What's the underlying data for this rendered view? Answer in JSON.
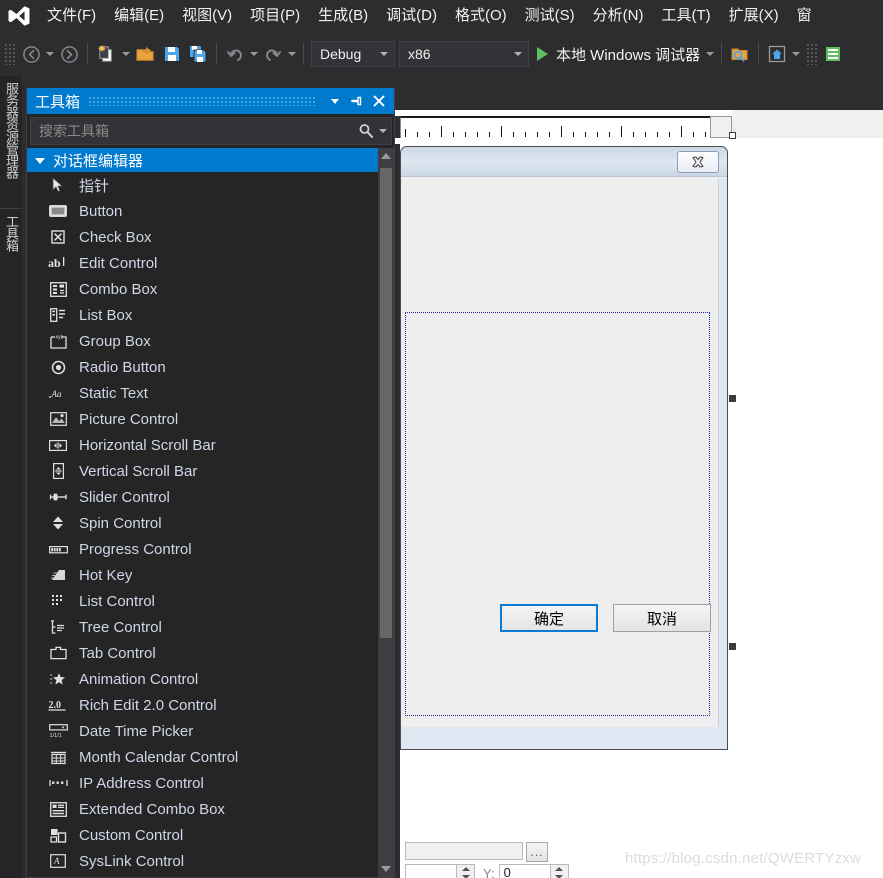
{
  "app": {
    "logo_icon": "visual-studio-logo-icon",
    "accent": "#007acc",
    "chrome_bg": "#2d2d30"
  },
  "menubar": {
    "items": [
      {
        "label": "文件(F)",
        "name": "menu-file"
      },
      {
        "label": "编辑(E)",
        "name": "menu-edit"
      },
      {
        "label": "视图(V)",
        "name": "menu-view"
      },
      {
        "label": "项目(P)",
        "name": "menu-project"
      },
      {
        "label": "生成(B)",
        "name": "menu-build"
      },
      {
        "label": "调试(D)",
        "name": "menu-debug"
      },
      {
        "label": "格式(O)",
        "name": "menu-format"
      },
      {
        "label": "测试(S)",
        "name": "menu-test"
      },
      {
        "label": "分析(N)",
        "name": "menu-analyze"
      },
      {
        "label": "工具(T)",
        "name": "menu-tools"
      },
      {
        "label": "扩展(X)",
        "name": "menu-extensions"
      },
      {
        "label": "窗",
        "name": "menu-window"
      }
    ]
  },
  "toolbar": {
    "back_icon": "navigate-back-icon",
    "forward_icon": "navigate-forward-icon",
    "new_item_icon": "new-item-icon",
    "open_icon": "open-file-icon",
    "save_icon": "save-icon",
    "save_all_icon": "save-all-icon",
    "undo_icon": "undo-icon",
    "redo_icon": "redo-icon",
    "config_value": "Debug",
    "platform_value": "x86",
    "run_label": "本地 Windows 调试器",
    "run_icon": "play-icon",
    "find_icon": "find-in-files-icon",
    "home_icon": "home-window-icon",
    "panel_icon": "panel-icon"
  },
  "vertical_dock": {
    "tabs": [
      {
        "label": "服务器资源管理器",
        "name": "vdock-tab-server-explorer"
      },
      {
        "label": "工具箱",
        "name": "vdock-tab-toolbox"
      }
    ]
  },
  "toolbox": {
    "title": "工具箱",
    "dropdown_icon": "chevron-down-icon",
    "pin_icon": "pin-icon",
    "close_icon": "close-icon",
    "search": {
      "placeholder": "搜索工具箱",
      "value": "",
      "icon": "search-icon",
      "caret_icon": "chevron-down-icon"
    },
    "group": {
      "label": "对话框编辑器",
      "expanded": true,
      "selected": true
    },
    "items": [
      {
        "label": "指针",
        "icon": "pointer-icon"
      },
      {
        "label": "Button",
        "icon": "button-icon"
      },
      {
        "label": "Check Box",
        "icon": "check-box-icon"
      },
      {
        "label": "Edit Control",
        "icon": "edit-control-icon"
      },
      {
        "label": "Combo Box",
        "icon": "combo-box-icon"
      },
      {
        "label": "List Box",
        "icon": "list-box-icon"
      },
      {
        "label": "Group Box",
        "icon": "group-box-icon"
      },
      {
        "label": "Radio Button",
        "icon": "radio-button-icon"
      },
      {
        "label": "Static Text",
        "icon": "static-text-icon"
      },
      {
        "label": "Picture Control",
        "icon": "picture-control-icon"
      },
      {
        "label": "Horizontal Scroll Bar",
        "icon": "horizontal-scroll-bar-icon"
      },
      {
        "label": "Vertical Scroll Bar",
        "icon": "vertical-scroll-bar-icon"
      },
      {
        "label": "Slider Control",
        "icon": "slider-control-icon"
      },
      {
        "label": "Spin Control",
        "icon": "spin-control-icon"
      },
      {
        "label": "Progress Control",
        "icon": "progress-control-icon"
      },
      {
        "label": "Hot Key",
        "icon": "hot-key-icon"
      },
      {
        "label": "List Control",
        "icon": "list-control-icon"
      },
      {
        "label": "Tree Control",
        "icon": "tree-control-icon"
      },
      {
        "label": "Tab Control",
        "icon": "tab-control-icon"
      },
      {
        "label": "Animation Control",
        "icon": "animation-control-icon"
      },
      {
        "label": "Rich Edit 2.0 Control",
        "icon": "rich-edit-2-icon"
      },
      {
        "label": "Date Time Picker",
        "icon": "date-time-picker-icon"
      },
      {
        "label": "Month Calendar Control",
        "icon": "month-calendar-icon"
      },
      {
        "label": "IP Address Control",
        "icon": "ip-address-icon"
      },
      {
        "label": "Extended Combo Box",
        "icon": "extended-combo-box-icon"
      },
      {
        "label": "Custom Control",
        "icon": "custom-control-icon"
      },
      {
        "label": "SysLink Control",
        "icon": "syslink-control-icon"
      }
    ],
    "scrollbar": {
      "up_icon": "scroll-up-icon",
      "down_icon": "scroll-down-icon"
    }
  },
  "editor": {
    "ruler_icon": "ruler-corner-icon",
    "dialog": {
      "close_icon": "dialog-close-icon",
      "ok_label": "确定",
      "cancel_label": "取消",
      "ok_focused": true
    }
  },
  "status_strip": {
    "browse_label": "...",
    "y_label": "Y:",
    "y_value": "0",
    "spin_up_icon": "spin-up-icon",
    "spin_down_icon": "spin-down-icon"
  },
  "watermark": {
    "text": "https://blog.csdn.net/QWERTYzxw"
  }
}
